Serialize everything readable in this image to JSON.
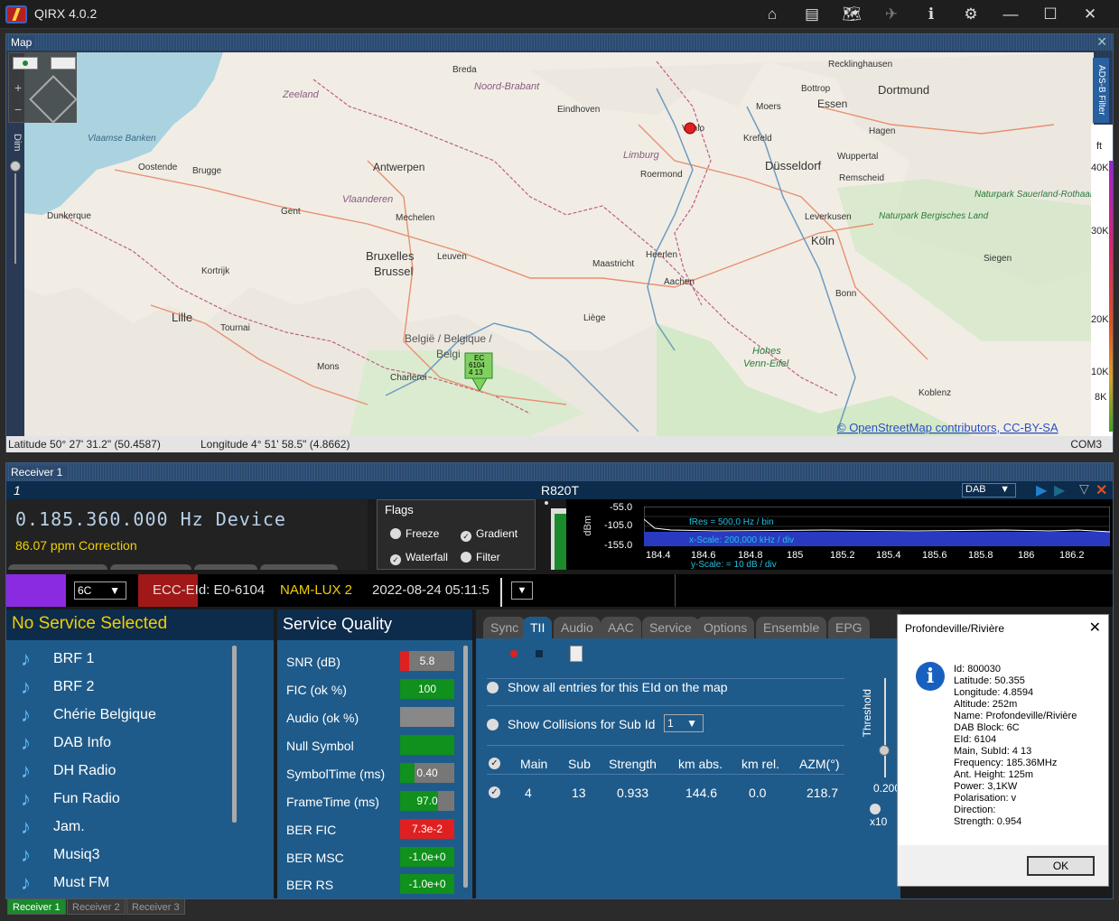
{
  "app": {
    "title": "QIRX 4.0.2"
  },
  "titlebar_icons": [
    "home-icon",
    "layout-icon",
    "map-icon",
    "satellite-icon",
    "info-icon",
    "gear-icon",
    "minimize-icon",
    "maximize-icon",
    "close-icon"
  ],
  "map": {
    "header": "Map",
    "adsb_label": "ADS-B Filter",
    "dim_label": "Dim",
    "alt_unit": "ft",
    "alt_ticks": [
      "40K",
      "30K",
      "20K",
      "10K",
      "8K"
    ],
    "latitude": "Latitude  50° 27' 31.2\" (50.4587)",
    "longitude": "Longitude  4° 51' 58.5\" (4.8662)",
    "port": "COM3",
    "attribution": "© OpenStreetMap contributors, CC-BY-SA",
    "marker_text": [
      "EC",
      "6104",
      "4  13"
    ],
    "places": [
      {
        "name": "Breda"
      },
      {
        "name": "Noord-Brabant"
      },
      {
        "name": "Zeeland"
      },
      {
        "name": "Eindhoven"
      },
      {
        "name": "Recklinghausen"
      },
      {
        "name": "Bottrop"
      },
      {
        "name": "Dortmund"
      },
      {
        "name": "Moers"
      },
      {
        "name": "Essen"
      },
      {
        "name": "Vlaamse Banken"
      },
      {
        "name": "Oostende"
      },
      {
        "name": "Brugge"
      },
      {
        "name": "Antwerpen"
      },
      {
        "name": "Venlo"
      },
      {
        "name": "Krefeld"
      },
      {
        "name": "Hagen"
      },
      {
        "name": "Limburg"
      },
      {
        "name": "Roermond"
      },
      {
        "name": "Düsseldorf"
      },
      {
        "name": "Wuppertal"
      },
      {
        "name": "Remscheid"
      },
      {
        "name": "Dunkerque"
      },
      {
        "name": "Gent"
      },
      {
        "name": "Vlaanderen"
      },
      {
        "name": "Mechelen"
      },
      {
        "name": "Leverkusen"
      },
      {
        "name": "Köln"
      },
      {
        "name": "Bruxelles"
      },
      {
        "name": "Brussel"
      },
      {
        "name": "Leuven"
      },
      {
        "name": "Maastricht"
      },
      {
        "name": "Heerlen"
      },
      {
        "name": "Siegen"
      },
      {
        "name": "Kortrijk"
      },
      {
        "name": "Aachen"
      },
      {
        "name": "Bonn"
      },
      {
        "name": "Lille"
      },
      {
        "name": "Tournai"
      },
      {
        "name": "Liège"
      },
      {
        "name": "België / Belgique /"
      },
      {
        "name": "Belgi"
      },
      {
        "name": "Mons"
      },
      {
        "name": "Charleroi"
      },
      {
        "name": "Hohes"
      },
      {
        "name": "Venn-Eifel"
      },
      {
        "name": "Koblenz"
      },
      {
        "name": "Naturpark Bergisches Land"
      },
      {
        "name": "Naturpark Sauerland-Rothaargebirge"
      }
    ]
  },
  "receiver": {
    "header": "Receiver 1",
    "number": "1",
    "device": "R820T",
    "mode": "DAB",
    "frequency": "0.185.360.000 Hz Device",
    "correction": "86.07 ppm Correction",
    "flags_title": "Flags",
    "flags": [
      {
        "label": "Freeze",
        "checked": false
      },
      {
        "label": "Gradient",
        "checked": true
      },
      {
        "label": "Waterfall",
        "checked": true
      },
      {
        "label": "Filter",
        "checked": false
      }
    ],
    "spectrum": {
      "y_axis_label": "dBm",
      "y_ticks": [
        "-55.0",
        "-105.0",
        "-155.0"
      ],
      "x_ticks": [
        "184.4",
        "184.6",
        "184.8",
        "185",
        "185.2",
        "185.4",
        "185.6",
        "185.8",
        "186",
        "186.2"
      ],
      "fres": "fRes = 500,0 Hz / bin",
      "xscale": "x-Scale: 200,000 kHz / div",
      "yscale": "y-Scale: = 10 dB / div"
    },
    "channel": "6C",
    "ecc_eid": "ECC-EId: E0-6104",
    "ensemble_name": "NAM-LUX 2",
    "datetime": "2022-08-24  05:11:5",
    "service_header": "No Service Selected",
    "services": [
      "BRF 1",
      "BRF 2",
      "Chérie Belgique",
      "DAB Info",
      "DH Radio",
      "Fun Radio",
      "Jam.",
      "Musiq3",
      "Must FM"
    ],
    "quality_header": "Service Quality",
    "quality": [
      {
        "label": "SNR (dB)",
        "value": "5.8",
        "color": "#777",
        "bar": "#e02020"
      },
      {
        "label": "FIC (ok %)",
        "value": "100",
        "color": "#10901c",
        "bar": ""
      },
      {
        "label": "Audio (ok %)",
        "value": "",
        "color": "#888",
        "bar": ""
      },
      {
        "label": "Null Symbol",
        "value": "",
        "color": "#10901c",
        "bar": ""
      },
      {
        "label": "SymbolTime (ms)",
        "value": "0.40",
        "color": "#777",
        "bar": "#10901c"
      },
      {
        "label": "FrameTime (ms)",
        "value": "97.0",
        "color": "#10901c",
        "bar": ""
      },
      {
        "label": "BER FIC",
        "value": "7.3e-2",
        "color": "#e02020",
        "bar": ""
      },
      {
        "label": "BER MSC",
        "value": "-1.0e+0",
        "color": "#10901c",
        "bar": ""
      },
      {
        "label": "BER RS",
        "value": "-1.0e+0",
        "color": "#10901c",
        "bar": ""
      }
    ],
    "tabs": [
      "Sync",
      "TII",
      "Audio",
      "AAC",
      "Service",
      "Options",
      "Ensemble",
      "EPG"
    ],
    "active_tab": "TII",
    "tii": {
      "show_all": "Show all entries for this EId on the map",
      "show_collisions": "Show Collisions for Sub Id",
      "sub_id_value": "1",
      "threshold_label": "Threshold",
      "threshold_value": "0.200",
      "x10_label": "x10",
      "columns": [
        "Main",
        "Sub",
        "Strength",
        "km abs.",
        "km rel.",
        "AZM(°)"
      ],
      "rows": [
        [
          "4",
          "13",
          "0.933",
          "144.6",
          "0.0",
          "218.7"
        ]
      ]
    }
  },
  "dialog": {
    "title": "Profondeville/Rivière",
    "body": "Id: 800030\nLatitude: 50.355\nLongitude: 4.8594\nAltitude: 252m\nName: Profondeville/Rivière\nDAB Block: 6C\nEId: 6104\nMain, SubId: 4 13\nFrequency: 185.36MHz\nAnt. Height: 125m\nPower: 3,1KW\nPolarisation: v\nDirection:\nStrength: 0.954",
    "ok": "OK"
  },
  "bottom_tabs": [
    "Receiver 1",
    "Receiver 2",
    "Receiver 3"
  ]
}
